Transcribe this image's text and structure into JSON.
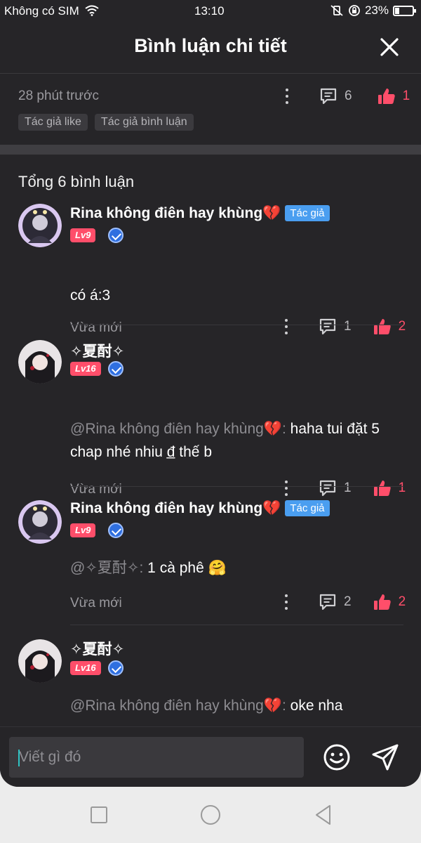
{
  "status_bar": {
    "carrier": "Không có SIM",
    "time": "13:10",
    "battery": "23%",
    "battery_level": 0.23
  },
  "header": {
    "title": "Bình luận chi tiết",
    "close_icon": "close-icon"
  },
  "post": {
    "time": "28 phút trước",
    "comment_count": "6",
    "like_count": "1",
    "tags": [
      "Tác giả like",
      "Tác giả bình luận"
    ]
  },
  "total_label": "Tổng 6 bình luận",
  "author_badge": "Tác giả",
  "comments": [
    {
      "name": "Rina không điên hay khùng💔",
      "is_author": true,
      "level": "Lv9",
      "mention": "",
      "text": "có á:3",
      "time": "Vừa mới",
      "replies": "1",
      "likes": "2"
    },
    {
      "name": "✧夏酎✧",
      "is_author": false,
      "level": "Lv16",
      "mention": "@Rina không điên hay khùng💔:",
      "text": " haha tui đặt 5 chap nhé nhiu đ̲ thế b",
      "time": "Vừa mới",
      "replies": "1",
      "likes": "1"
    },
    {
      "name": "Rina không điên hay khùng💔",
      "is_author": true,
      "level": "Lv9",
      "mention": "@✧夏酎✧:",
      "text": " 1 cà phê 🤗",
      "time": "Vừa mới",
      "replies": "2",
      "likes": "2"
    },
    {
      "name": "✧夏酎✧",
      "is_author": false,
      "level": "Lv16",
      "mention": "@Rina không điên hay khùng💔:",
      "text": " oke nha",
      "time": "",
      "replies": "",
      "likes": ""
    }
  ],
  "composer": {
    "placeholder": "Viết gì đó"
  },
  "colors": {
    "background": "#262528",
    "accent_like": "#ff4e6a",
    "author_badge": "#4a9ef0",
    "level_badge": "#ff4e6a"
  },
  "icons": [
    "close-icon",
    "more-icon",
    "comment-icon",
    "like-icon",
    "emoji-icon",
    "send-icon",
    "wifi-icon",
    "battery-icon",
    "nav-recent-icon",
    "nav-home-icon",
    "nav-back-icon"
  ]
}
